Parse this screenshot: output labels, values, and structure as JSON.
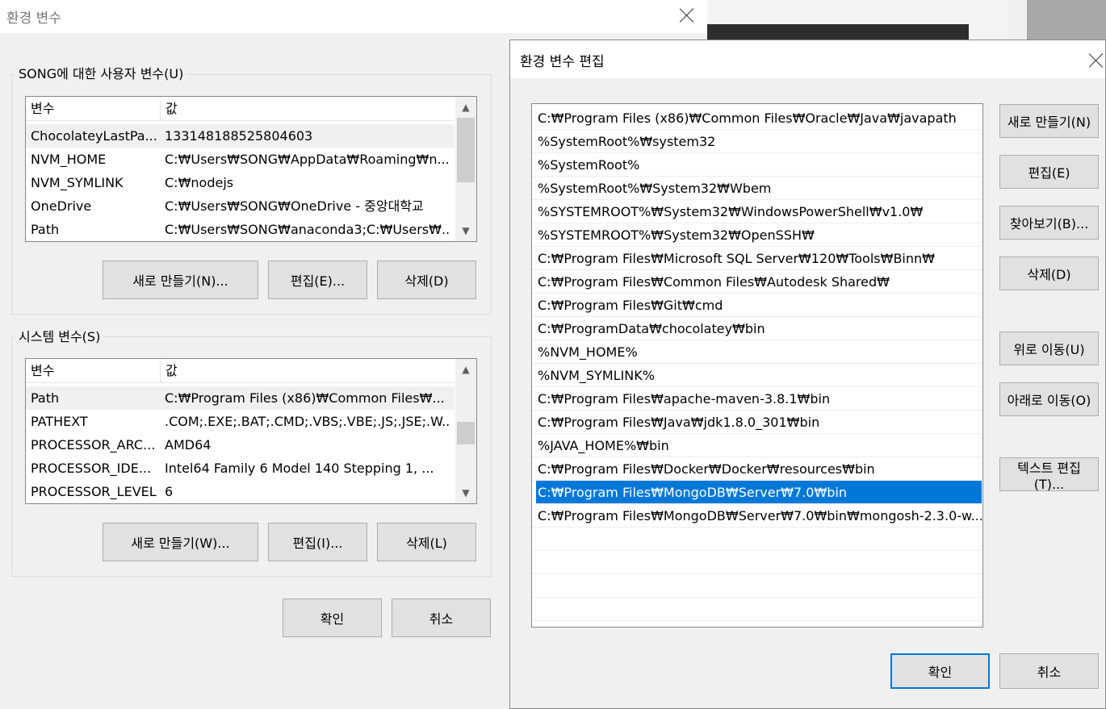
{
  "main_dialog": {
    "title": "환경 변수",
    "user_group_label": "SONG에 대한 사용자 변수(U)",
    "user_vars": {
      "headers": [
        "변수",
        "값"
      ],
      "rows": [
        {
          "name": "ChocolateyLastPa...",
          "value": "133148188525804603"
        },
        {
          "name": "NVM_HOME",
          "value": "C:₩Users₩SONG₩AppData₩Roaming₩n..."
        },
        {
          "name": "NVM_SYMLINK",
          "value": "C:₩nodejs"
        },
        {
          "name": "OneDrive",
          "value": "C:₩Users₩SONG₩OneDrive - 중앙대학교"
        },
        {
          "name": "Path",
          "value": "C:₩Users₩SONG₩anaconda3;C:₩Users₩..."
        }
      ]
    },
    "user_buttons": {
      "new": "새로 만들기(N)...",
      "edit": "편집(E)...",
      "delete": "삭제(D)"
    },
    "system_group_label": "시스템 변수(S)",
    "system_vars": {
      "headers": [
        "변수",
        "값"
      ],
      "rows": [
        {
          "name": "Path",
          "value": "C:₩Program Files (x86)₩Common Files₩..."
        },
        {
          "name": "PATHEXT",
          "value": ".COM;.EXE;.BAT;.CMD;.VBS;.VBE;.JS;.JSE;.W..."
        },
        {
          "name": "PROCESSOR_ARC...",
          "value": "AMD64"
        },
        {
          "name": "PROCESSOR_IDE...",
          "value": "Intel64 Family 6 Model 140 Stepping 1, ..."
        },
        {
          "name": "PROCESSOR_LEVEL",
          "value": "6"
        }
      ]
    },
    "system_buttons": {
      "new": "새로 만들기(W)...",
      "edit": "편집(I)...",
      "delete": "삭제(L)"
    },
    "ok": "확인",
    "cancel": "취소"
  },
  "edit_dialog": {
    "title": "환경 변수 편집",
    "paths": [
      "C:₩Program Files (x86)₩Common Files₩Oracle₩Java₩javapath",
      "%SystemRoot%₩system32",
      "%SystemRoot%",
      "%SystemRoot%₩System32₩Wbem",
      "%SYSTEMROOT%₩System32₩WindowsPowerShell₩v1.0₩",
      "%SYSTEMROOT%₩System32₩OpenSSH₩",
      "C:₩Program Files₩Microsoft SQL Server₩120₩Tools₩Binn₩",
      "C:₩Program Files₩Common Files₩Autodesk Shared₩",
      "C:₩Program Files₩Git₩cmd",
      "C:₩ProgramData₩chocolatey₩bin",
      "%NVM_HOME%",
      "%NVM_SYMLINK%",
      "C:₩Program Files₩apache-maven-3.8.1₩bin",
      "C:₩Program Files₩Java₩jdk1.8.0_301₩bin",
      "%JAVA_HOME%₩bin",
      "C:₩Program Files₩Docker₩Docker₩resources₩bin",
      "C:₩Program Files₩MongoDB₩Server₩7.0₩bin",
      "C:₩Program Files₩MongoDB₩Server₩7.0₩bin₩mongosh-2.3.0-w..."
    ],
    "selected_index": 16,
    "buttons": {
      "new": "새로 만들기(N)",
      "edit": "편집(E)",
      "browse": "찾아보기(B)...",
      "delete": "삭제(D)",
      "move_up": "위로 이동(U)",
      "move_down": "아래로 이동(O)",
      "edit_text": "텍스트 편집(T)..."
    },
    "ok": "확인",
    "cancel": "취소"
  }
}
